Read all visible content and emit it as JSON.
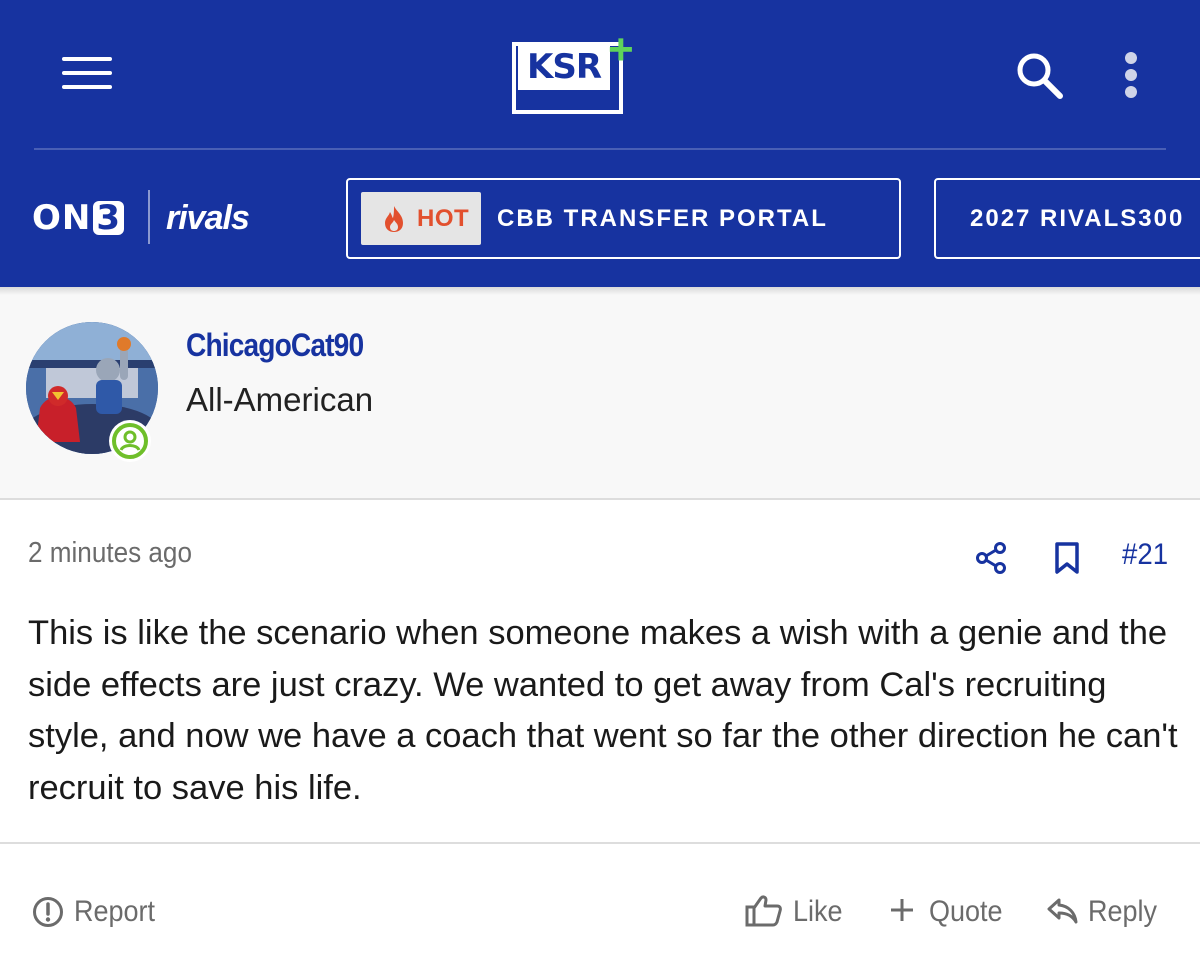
{
  "header": {
    "logo_text": "KSR",
    "logo_plus": "+",
    "brand_on3_prefix": "ON",
    "brand_on3_suffix": "3",
    "brand_rivals": "rivals",
    "icons": [
      "menu-icon",
      "search-icon",
      "more-vert-icon",
      "flame-icon"
    ],
    "nav_pills": [
      {
        "tag": "HOT",
        "label": "CBB TRANSFER PORTAL"
      },
      {
        "label": "2027 RIVALS300"
      }
    ]
  },
  "user": {
    "username": "ChicagoCat90",
    "title": "All-American"
  },
  "post": {
    "time": "2 minutes ago",
    "number": "#21",
    "body": "This is like the scenario when someone makes a wish with a genie and the side effects are just crazy. We wanted to get away from Cal's recruiting style, and now we have a coach that went so far the other direction he can't recruit to save his life."
  },
  "actions": {
    "report": "Report",
    "like": "Like",
    "quote": "Quote",
    "reply": "Reply"
  },
  "colors": {
    "header_bg": "#1733a0",
    "link_blue": "#1733a0",
    "hot_orange": "#e2502e",
    "online_green": "#6fbf2a",
    "plus_green": "#5fd35a"
  }
}
